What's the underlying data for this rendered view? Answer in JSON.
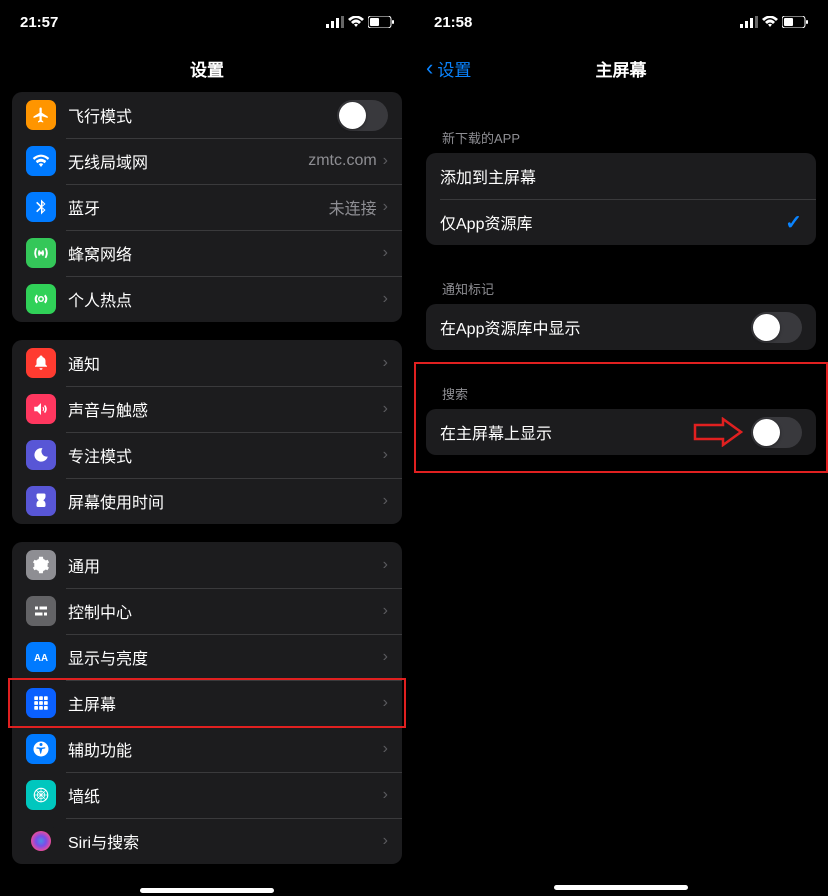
{
  "left": {
    "time": "21:57",
    "title": "设置",
    "groups": [
      {
        "rows": [
          {
            "icon": "airplane-icon",
            "bg": "bg-orange",
            "label": "飞行模式",
            "control": "toggle"
          },
          {
            "icon": "wifi-icon",
            "bg": "bg-blue",
            "label": "无线局域网",
            "detail": "zmtc.com",
            "control": "disclosure"
          },
          {
            "icon": "bluetooth-icon",
            "bg": "bg-blue",
            "label": "蓝牙",
            "detail": "未连接",
            "control": "disclosure"
          },
          {
            "icon": "cellular-icon",
            "bg": "bg-green",
            "label": "蜂窝网络",
            "control": "disclosure"
          },
          {
            "icon": "hotspot-icon",
            "bg": "bg-green2",
            "label": "个人热点",
            "control": "disclosure"
          }
        ]
      },
      {
        "rows": [
          {
            "icon": "notifications-icon",
            "bg": "bg-red",
            "label": "通知",
            "control": "disclosure"
          },
          {
            "icon": "sounds-icon",
            "bg": "bg-red2",
            "label": "声音与触感",
            "control": "disclosure"
          },
          {
            "icon": "focus-icon",
            "bg": "bg-indigo",
            "label": "专注模式",
            "control": "disclosure"
          },
          {
            "icon": "screentime-icon",
            "bg": "bg-indigo",
            "label": "屏幕使用时间",
            "control": "disclosure"
          }
        ]
      },
      {
        "rows": [
          {
            "icon": "general-icon",
            "bg": "bg-gray",
            "label": "通用",
            "control": "disclosure"
          },
          {
            "icon": "controlcenter-icon",
            "bg": "bg-grey2",
            "label": "控制中心",
            "control": "disclosure"
          },
          {
            "icon": "display-icon",
            "bg": "bg-blue",
            "label": "显示与亮度",
            "control": "disclosure"
          },
          {
            "icon": "homescreen-icon",
            "bg": "bg-darkblue",
            "label": "主屏幕",
            "control": "disclosure",
            "highlighted": true
          },
          {
            "icon": "accessibility-icon",
            "bg": "bg-blue",
            "label": "辅助功能",
            "control": "disclosure"
          },
          {
            "icon": "wallpaper-icon",
            "bg": "bg-cyan",
            "label": "墙纸",
            "control": "disclosure"
          },
          {
            "icon": "siri-icon",
            "bg": "",
            "label": "Siri与搜索",
            "control": "disclosure"
          }
        ]
      }
    ]
  },
  "right": {
    "time": "21:58",
    "back": "设置",
    "title": "主屏幕",
    "groups": [
      {
        "header": "新下载的APP",
        "rows": [
          {
            "label": "添加到主屏幕",
            "control": "none"
          },
          {
            "label": "仅App资源库",
            "control": "check"
          }
        ]
      },
      {
        "header": "通知标记",
        "rows": [
          {
            "label": "在App资源库中显示",
            "control": "toggle"
          }
        ]
      },
      {
        "header": "搜索",
        "rows": [
          {
            "label": "在主屏幕上显示",
            "control": "toggle",
            "highlighted": true
          }
        ]
      }
    ]
  }
}
